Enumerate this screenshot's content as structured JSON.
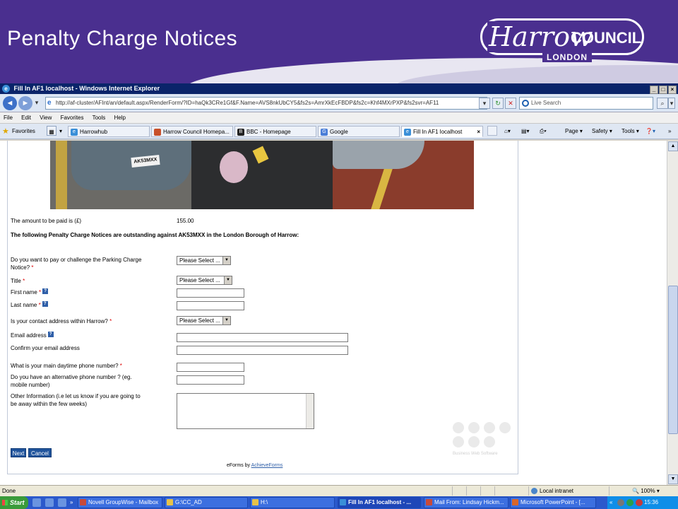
{
  "slide": {
    "title": "Penalty Charge Notices",
    "logo": {
      "harrow": "Harrow",
      "council": "COUNCIL",
      "london": "LONDON"
    }
  },
  "browser": {
    "window_title": "Fill In AF1 localhost - Windows Internet Explorer",
    "address_url": "http://af-cluster/AFInt/an/default.aspx/RenderForm/?ID=haQk3CRe1Gf&F.Name=AVS8nkUbCY5&fs2s=AmrXkEcFBDP&fs2c=Khf4MXrPXP&fs2svr=AF11",
    "search_placeholder": "Live Search",
    "menu": [
      "File",
      "Edit",
      "View",
      "Favorites",
      "Tools",
      "Help"
    ],
    "favorites_label": "Favorites",
    "tabs": [
      {
        "label": "Harrowhub",
        "icon": "ie-page-icon"
      },
      {
        "label": "Harrow Council Homepa...",
        "icon": "harrow-page-icon"
      },
      {
        "label": "BBC - Homepage",
        "icon": "bbc-icon"
      },
      {
        "label": "Google",
        "icon": "google-icon"
      },
      {
        "label": "Fill In AF1 localhost",
        "icon": "ie-page-icon",
        "active": true
      }
    ],
    "commands": [
      "Page",
      "Safety",
      "Tools"
    ],
    "status_text": "Done",
    "zone_text": "Local intranet",
    "zoom_text": "100%"
  },
  "photo": {
    "plate": "AK53MXX"
  },
  "form": {
    "amount_label": "The amount to be paid is (£)",
    "amount_value": "155.00",
    "outstanding_text": "The following Penalty Charge Notices are outstanding against AK53MXX in the London Borough of Harrow:",
    "pay_challenge_label_1": "Do you want to pay or challenge the Parking Charge",
    "pay_challenge_label_2": "Notice?",
    "title_label": "Title",
    "first_name_label": "First name",
    "last_name_label": "Last name",
    "contact_address_label": "Is your contact address within Harrow?",
    "email_label": "Email address",
    "confirm_email_label": "Confirm your email address",
    "daytime_phone_label": "What is your main daytime phone number?",
    "alt_phone_label_1": "Do you have an alternative phone number ? (eg.",
    "alt_phone_label_2": "mobile number)",
    "other_info_label_1": "Other Information (i.e let us know if you are going to",
    "other_info_label_2": "be away within the few weeks)",
    "select_placeholder": "Please Select ...",
    "required_mark": "*",
    "help_mark": "?",
    "next_button": "Next",
    "cancel_button": "Cancel",
    "footer_prefix": "eForms by",
    "footer_link": "AchieveForms",
    "watermark_text": "Business Web Software"
  },
  "taskbar": {
    "start_label": "Start",
    "buttons": [
      {
        "label": "Novell GroupWise - Mailbox",
        "color": "#c84a3a"
      },
      {
        "label": "G:\\CC_AD",
        "color": "#e6c24a"
      },
      {
        "label": "H:\\",
        "color": "#e6c24a"
      },
      {
        "label": "Fill In AF1 localhost - ...",
        "color": "#3a8fd8",
        "active": true
      },
      {
        "label": "Mail From: Lindsay Hickm...",
        "color": "#c84a3a"
      },
      {
        "label": "Microsoft PowerPoint - [...",
        "color": "#d9662a"
      }
    ],
    "clock": "15:36"
  },
  "colors": {
    "brand_purple": "#4a2f8f",
    "button_blue": "#20549c",
    "required_red": "#dd0000"
  }
}
